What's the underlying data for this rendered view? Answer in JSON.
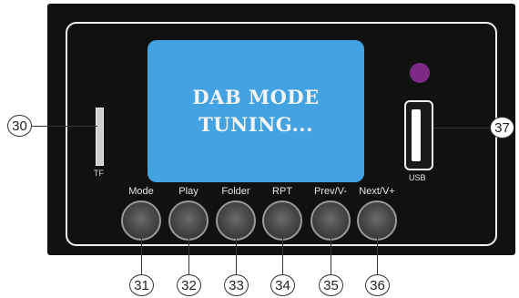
{
  "screen": {
    "line1": "DAB MODE",
    "line2": "TUNING..."
  },
  "tf_label": "TF",
  "usb_label": "USB",
  "buttons": [
    {
      "label": "Mode",
      "callout": "31"
    },
    {
      "label": "Play",
      "callout": "32"
    },
    {
      "label": "Folder",
      "callout": "33"
    },
    {
      "label": "RPT",
      "callout": "34"
    },
    {
      "label": "Prev/V-",
      "callout": "35"
    },
    {
      "label": "Next/V+",
      "callout": "36"
    }
  ],
  "callouts": {
    "tf": "30",
    "usb": "37"
  },
  "colors": {
    "panel": "#111111",
    "screen": "#42a2e2",
    "led": "#7c2a86"
  }
}
